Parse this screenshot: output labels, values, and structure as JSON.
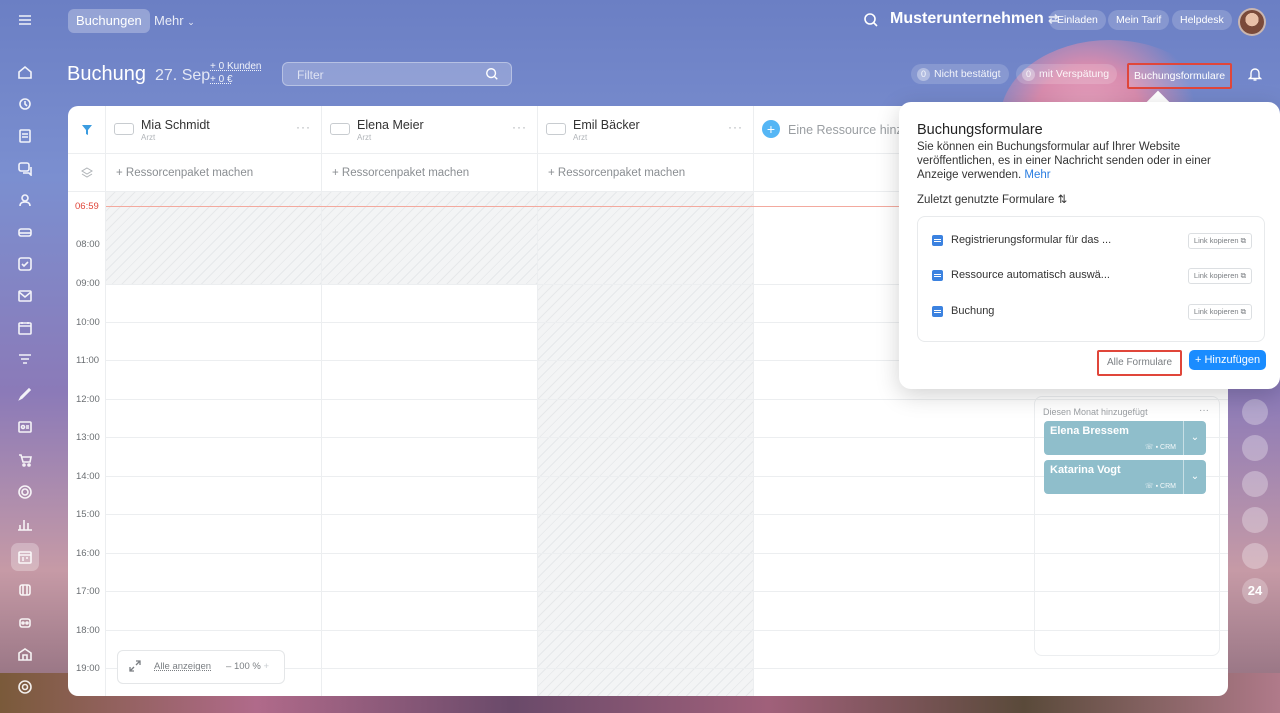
{
  "topbar": {
    "tab_bookings": "Buchungen",
    "tab_more": "Mehr",
    "company": "Musterunternehmen",
    "invite": "Einladen",
    "my_plan": "Mein Tarif",
    "helpdesk": "Helpdesk"
  },
  "header": {
    "title": "Buchung",
    "date": "27. Sep",
    "stat_customers": "+ 0 Kunden",
    "stat_money": "+ 0 €",
    "filter_placeholder": "Filter",
    "not_confirmed_count": "0",
    "not_confirmed": "Nicht bestätigt",
    "late_count": "0",
    "late": "mit Verspätung",
    "booking_forms": "Buchungsformulare"
  },
  "resources": [
    {
      "name": "Mia Schmidt",
      "role": "Arzt",
      "package": "+ Ressorcenpaket machen"
    },
    {
      "name": "Elena Meier",
      "role": "Arzt",
      "package": "+ Ressorcenpaket machen"
    },
    {
      "name": "Emil Bäcker",
      "role": "Arzt",
      "package": "+ Ressorcenpaket machen"
    }
  ],
  "add_resource": "Eine Ressource hinzu",
  "now_time": "06:59",
  "times": [
    "08:00",
    "09:00",
    "10:00",
    "11:00",
    "12:00",
    "13:00",
    "14:00",
    "15:00",
    "16:00",
    "17:00",
    "18:00",
    "19:00"
  ],
  "zoom": {
    "show_all": "Alle anzeigen",
    "level": "100 %"
  },
  "sidebar": {
    "label": "Diesen Monat hinzugefügt",
    "clients": [
      {
        "name": "Elena Bressem",
        "crm": "CRM"
      },
      {
        "name": "Katarina Vogt",
        "crm": "CRM"
      }
    ]
  },
  "popup": {
    "title": "Buchungsformulare",
    "description": "Sie können ein Buchungsformular auf Ihrer Website veröffentlichen, es in einer Nachricht senden oder in einer Anzeige verwenden.",
    "more_link": "Mehr",
    "recent_label": "Zuletzt genutzte Formulare",
    "forms": [
      {
        "name": "Registrierungsformular für das ...",
        "copy": "Link kopieren"
      },
      {
        "name": "Ressource automatisch auswä...",
        "copy": "Link kopieren"
      },
      {
        "name": "Buchung",
        "copy": "Link kopieren"
      }
    ],
    "all_forms": "Alle Formulare",
    "add": "+ Hinzufügen"
  },
  "right_strip": {
    "badge": "24"
  },
  "colors": {
    "accent": "#1a8cff",
    "highlight": "#e0463a",
    "client_card": "#8fbecb"
  }
}
